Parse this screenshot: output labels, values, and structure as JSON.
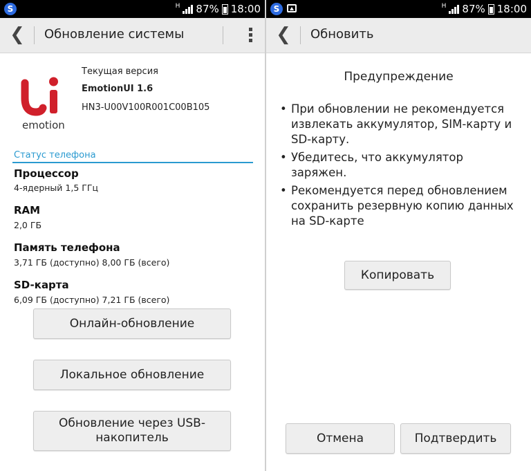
{
  "status_bar": {
    "battery": "87%",
    "time": "18:00",
    "network_mark": "H"
  },
  "left": {
    "title": "Обновление системы",
    "logo_text": "emotion",
    "version_label": "Текущая версия",
    "version_name": "EmotionUI 1.6",
    "build": "HN3-U00V100R001C00B105",
    "section_title": "Статус телефона",
    "info": [
      {
        "label": "Процессор",
        "value": "4-ядерный 1,5 ГГц"
      },
      {
        "label": "RAM",
        "value": "2,0 ГБ"
      },
      {
        "label": "Память телефона",
        "value": "3,71 ГБ (доступно)  8,00 ГБ (всего)"
      },
      {
        "label": "SD-карта",
        "value": "6,09 ГБ (доступно)  7,21 ГБ (всего)"
      }
    ],
    "buttons": [
      "Онлайн-обновление",
      "Локальное обновление",
      "Обновление через USB-накопитель"
    ]
  },
  "right": {
    "title": "Обновить",
    "warning_title": "Предупреждение",
    "bullets": [
      "При обновлении не рекомендуется извлекать аккумулятор, SIM-карту и SD-карту.",
      "Убедитесь, что аккумулятор заряжен.",
      "Рекомендуется перед обновлением сохранить резервную копию данных на SD-карте"
    ],
    "copy_button": "Копировать",
    "cancel_button": "Отмена",
    "confirm_button": "Подтвердить"
  },
  "colors": {
    "accent": "#2a9ad0",
    "logo_red": "#d0202b",
    "appbar_bg": "#ececec",
    "app_icon_blue": "#2d6be0"
  }
}
